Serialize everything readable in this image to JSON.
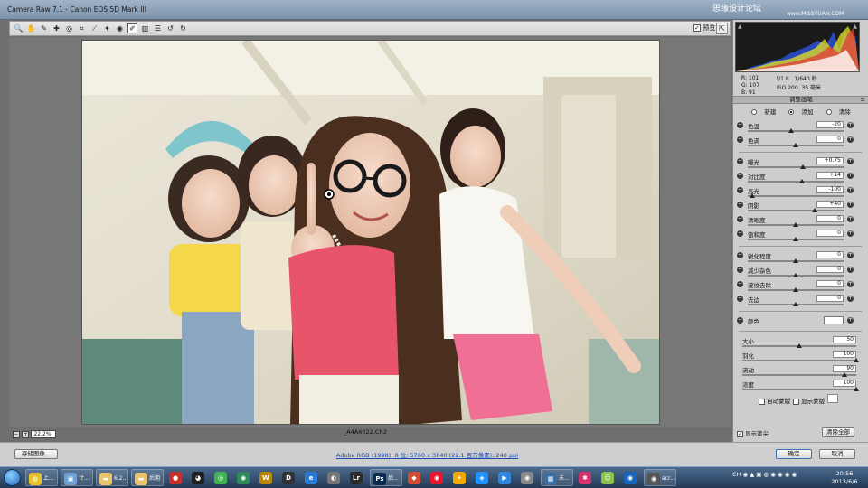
{
  "window": {
    "title": "Camera Raw 7.1 -  Canon EOS 5D Mark III",
    "watermark": "思缘设计论坛",
    "watermark_url": "www.MISSYUAN.COM"
  },
  "toolbar": {
    "tools": [
      {
        "name": "zoom-tool-icon",
        "glyph": "🔍"
      },
      {
        "name": "hand-tool-icon",
        "glyph": "✋"
      },
      {
        "name": "white-balance-tool-icon",
        "glyph": "✎"
      },
      {
        "name": "color-sampler-tool-icon",
        "glyph": "✚"
      },
      {
        "name": "targeted-adjustment-tool-icon",
        "glyph": "◎"
      },
      {
        "name": "crop-tool-icon",
        "glyph": "⌗"
      },
      {
        "name": "straighten-tool-icon",
        "glyph": "⟋"
      },
      {
        "name": "spot-removal-tool-icon",
        "glyph": "✦"
      },
      {
        "name": "red-eye-tool-icon",
        "glyph": "◉"
      },
      {
        "name": "adjustment-brush-tool-icon",
        "glyph": "✐",
        "active": true
      },
      {
        "name": "graduated-filter-tool-icon",
        "glyph": "▥"
      },
      {
        "name": "preferences-icon",
        "glyph": "☰"
      },
      {
        "name": "rotate-left-icon",
        "glyph": "↺"
      },
      {
        "name": "rotate-right-icon",
        "glyph": "↻"
      }
    ],
    "preview_label": "预览",
    "preview_checked": "✓"
  },
  "image": {
    "filename": "_A4A6022.CR2"
  },
  "zoom": {
    "value": "22.2%",
    "minus": "−",
    "plus": "+"
  },
  "panel": {
    "readout": {
      "r": "R:   101",
      "g": "G:   107",
      "b": "B:   91",
      "exposure_info": "f/1.8   1/640 秒\nISO 200  35 毫米"
    },
    "header": "调整画笔",
    "menu_icon": "≡",
    "modes": {
      "new": "新建",
      "add": "添加",
      "clear": "清除"
    },
    "sliders": [
      {
        "name": "temperature",
        "label": "色温",
        "value": "-20",
        "pos": 0.45
      },
      {
        "name": "tint",
        "label": "色调",
        "value": "0",
        "pos": 0.5
      },
      {
        "name": "exposure",
        "label": "曝光",
        "value": "+0.75",
        "pos": 0.58
      },
      {
        "name": "contrast",
        "label": "对比度",
        "value": "+14",
        "pos": 0.57
      },
      {
        "name": "highlights",
        "label": "高光",
        "value": "-100",
        "pos": 0.05
      },
      {
        "name": "shadows",
        "label": "阴影",
        "value": "+40",
        "pos": 0.7
      },
      {
        "name": "clarity",
        "label": "清晰度",
        "value": "0",
        "pos": 0.5
      },
      {
        "name": "saturation",
        "label": "饱和度",
        "value": "0",
        "pos": 0.5
      },
      {
        "name": "sharpness",
        "label": "锐化程度",
        "value": "0",
        "pos": 0.5
      },
      {
        "name": "noise-reduction",
        "label": "减少杂色",
        "value": "0",
        "pos": 0.5
      },
      {
        "name": "moire-reduction",
        "label": "波纹去除",
        "value": "0",
        "pos": 0.5
      },
      {
        "name": "defringe",
        "label": "去边",
        "value": "0",
        "pos": 0.5
      }
    ],
    "color_label": "颜色",
    "brush": [
      {
        "name": "size",
        "label": "大小",
        "value": "50",
        "pos": 0.5
      },
      {
        "name": "feather",
        "label": "羽化",
        "value": "100",
        "pos": 1.0
      },
      {
        "name": "flow",
        "label": "流动",
        "value": "90",
        "pos": 0.9
      },
      {
        "name": "density",
        "label": "浓度",
        "value": "100",
        "pos": 1.0
      }
    ],
    "auto_mask": "自动蒙版",
    "show_mask": "显示蒙版",
    "show_pins": "显示笔尖",
    "clear_all": "清除全部"
  },
  "bottom": {
    "save_image": "存储图像...",
    "workflow": "Adobe RGB (1998); 8 位; 5760 x 3840 (22.1 百万像素); 240 ppi",
    "done": "确定",
    "cancel": "取消"
  },
  "taskbar": {
    "items": [
      {
        "name": "chrome-icon",
        "color": "#e8c229",
        "glyph": "◍",
        "label": "上..."
      },
      {
        "name": "computer-icon",
        "color": "#6ea0d8",
        "glyph": "▣",
        "label": "计..."
      },
      {
        "name": "folder-icon",
        "color": "#e9c46a",
        "glyph": "▬",
        "label": "6.2..."
      },
      {
        "name": "folder-icon-2",
        "color": "#e9c46a",
        "glyph": "▬",
        "label": "后期"
      },
      {
        "name": "app-icon-1",
        "color": "#c9302c",
        "glyph": "●",
        "label": ""
      },
      {
        "name": "qq-icon",
        "color": "#1f1f1f",
        "glyph": "◕",
        "label": ""
      },
      {
        "name": "app-icon-2",
        "color": "#3fb34f",
        "glyph": "◎",
        "label": ""
      },
      {
        "name": "app-icon-3",
        "color": "#2e8b57",
        "glyph": "◉",
        "label": ""
      },
      {
        "name": "app-icon-4",
        "color": "#b8860b",
        "glyph": "W",
        "label": ""
      },
      {
        "name": "app-icon-5",
        "color": "#333333",
        "glyph": "D",
        "label": ""
      },
      {
        "name": "ie-icon",
        "color": "#2a7bd8",
        "glyph": "e",
        "label": ""
      },
      {
        "name": "app-icon-6",
        "color": "#777777",
        "glyph": "◐",
        "label": ""
      },
      {
        "name": "lightroom-icon",
        "color": "#2b2b2b",
        "glyph": "Lr",
        "label": ""
      },
      {
        "name": "photoshop-icon",
        "color": "#0a2a4d",
        "glyph": "Ps",
        "label": "后..."
      },
      {
        "name": "app-icon-7",
        "color": "#d34a35",
        "glyph": "◆",
        "label": ""
      },
      {
        "name": "weibo-icon",
        "color": "#e6162d",
        "glyph": "◉",
        "label": ""
      },
      {
        "name": "app-icon-8",
        "color": "#f2a900",
        "glyph": "✦",
        "label": ""
      },
      {
        "name": "app-icon-9",
        "color": "#1e90ff",
        "glyph": "◈",
        "label": ""
      },
      {
        "name": "app-icon-10",
        "color": "#2e86de",
        "glyph": "▶",
        "label": ""
      },
      {
        "name": "app-icon-11",
        "color": "#888888",
        "glyph": "◉",
        "label": ""
      },
      {
        "name": "app-icon-12",
        "color": "#3a6ea5",
        "glyph": "▦",
        "label": "未..."
      },
      {
        "name": "app-icon-13",
        "color": "#d6336c",
        "glyph": "✱",
        "label": ""
      },
      {
        "name": "app-icon-14",
        "color": "#8bc34a",
        "glyph": "☺",
        "label": ""
      },
      {
        "name": "app-icon-15",
        "color": "#1565c0",
        "glyph": "◉",
        "label": ""
      },
      {
        "name": "app-icon-16",
        "color": "#555555",
        "glyph": "◉",
        "label": "acr..."
      }
    ],
    "tray": "CH  ◉  ▲  ▣  ◍  ◉  ◉  ◉  ◉",
    "time": "20:56",
    "date": "2013/6/6"
  }
}
